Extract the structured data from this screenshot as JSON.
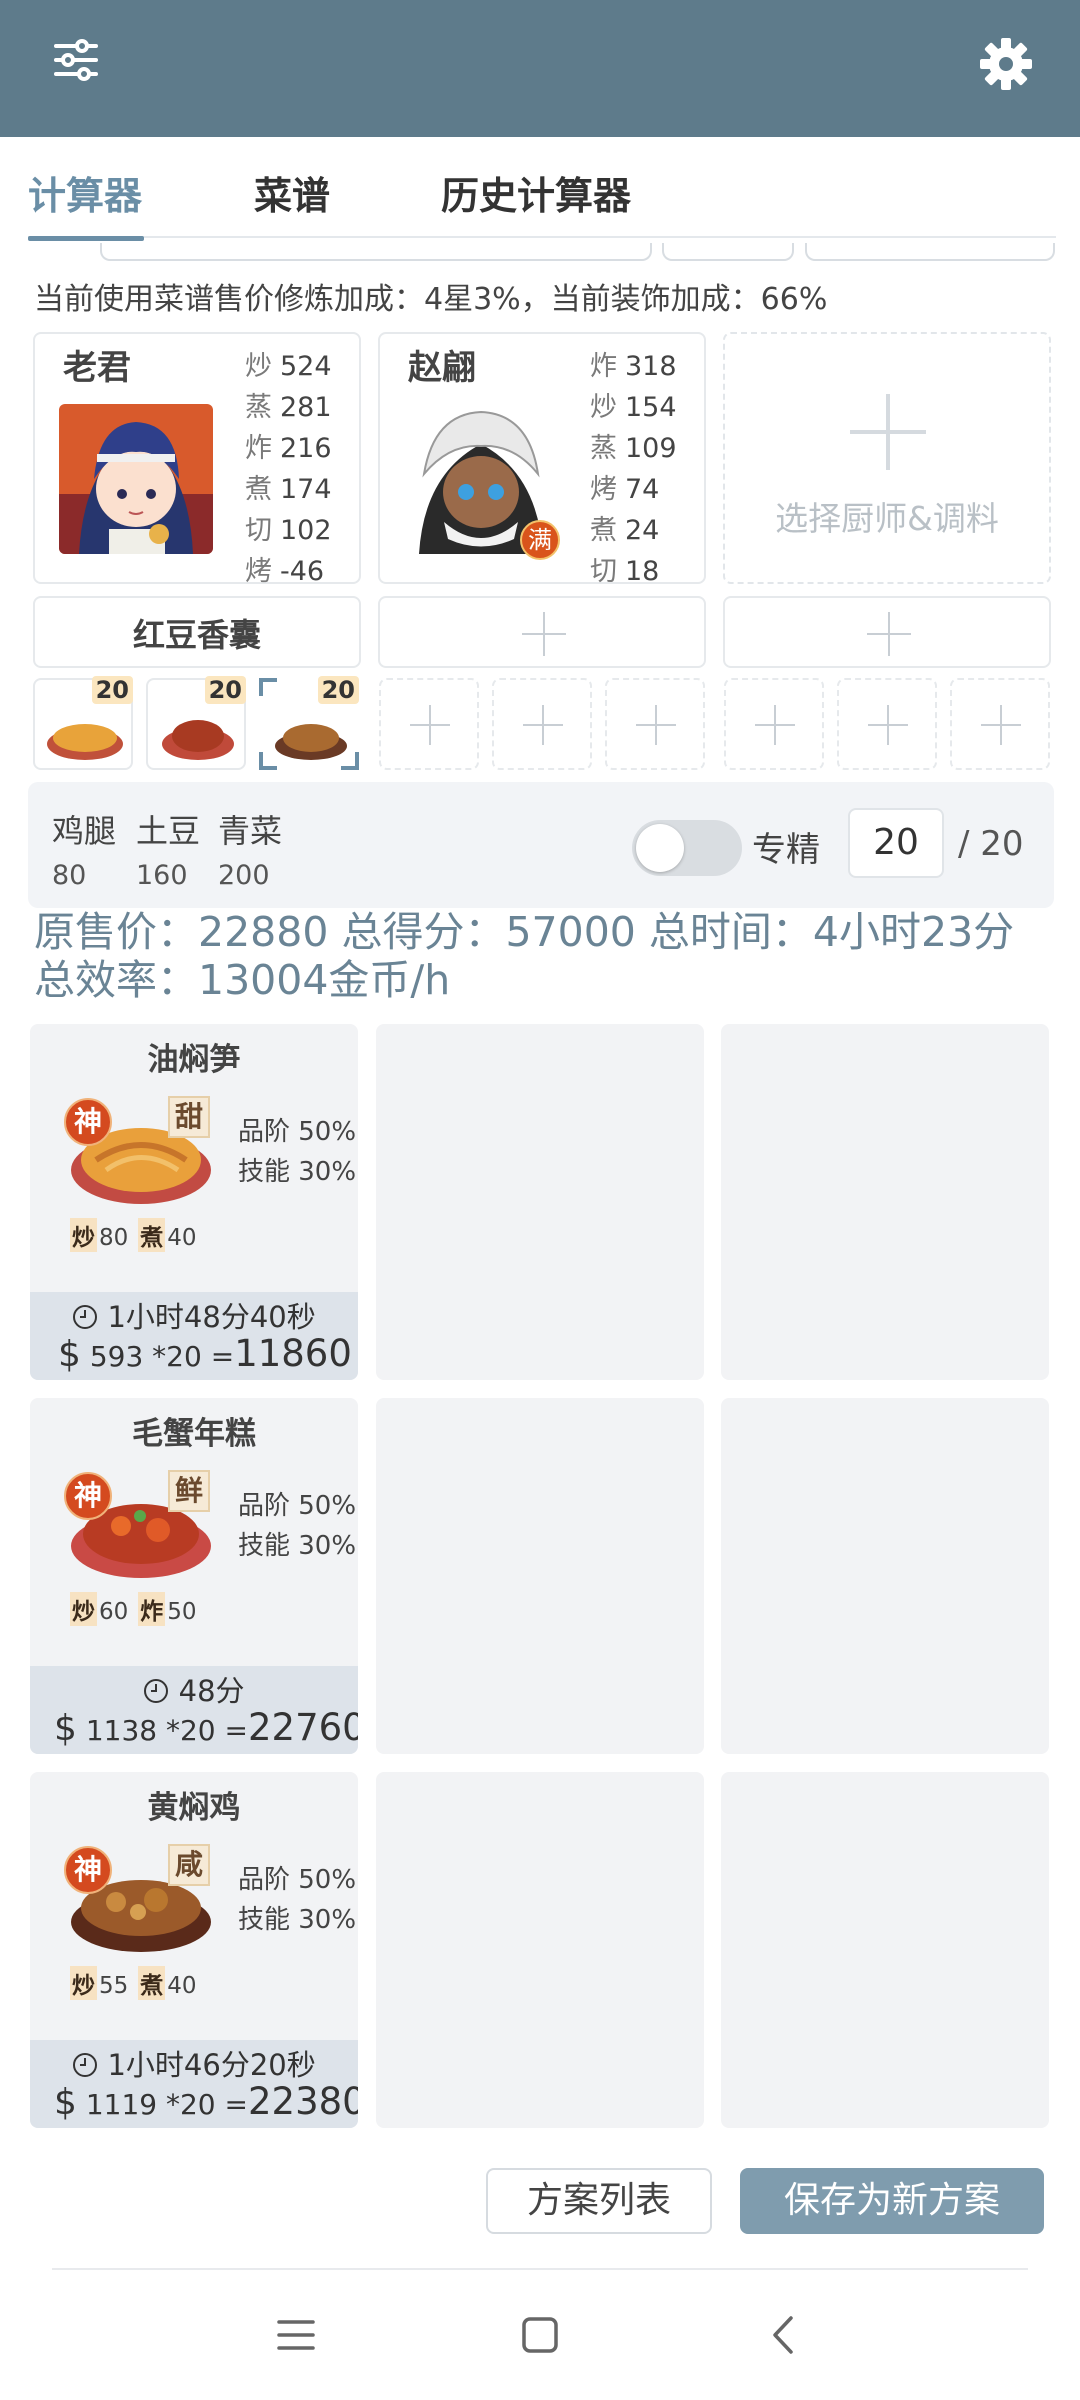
{
  "tabs": [
    {
      "label": "计算器",
      "active": true
    },
    {
      "label": "菜谱",
      "active": false
    },
    {
      "label": "历史计算器",
      "active": false
    }
  ],
  "info_line": "当前使用菜谱售价修炼加成：4星3%，当前装饰加成：66%",
  "chefs": [
    {
      "name": "老君",
      "stats": [
        {
          "k": "炒",
          "v": "524"
        },
        {
          "k": "蒸",
          "v": "281"
        },
        {
          "k": "炸",
          "v": "216"
        },
        {
          "k": "煮",
          "v": "174"
        },
        {
          "k": "切",
          "v": "102"
        },
        {
          "k": "烤",
          "v": "-46"
        }
      ]
    },
    {
      "name": "赵翩",
      "badge": "满",
      "stats": [
        {
          "k": "炸",
          "v": "318"
        },
        {
          "k": "炒",
          "v": "154"
        },
        {
          "k": "蒸",
          "v": "109"
        },
        {
          "k": "烤",
          "v": "74"
        },
        {
          "k": "煮",
          "v": "24"
        },
        {
          "k": "切",
          "v": "18"
        }
      ]
    }
  ],
  "add_chef_label": "选择厨师&调料",
  "equipment": {
    "slot1": "红豆香囊"
  },
  "dish_slots": [
    {
      "level": "20"
    },
    {
      "level": "20"
    },
    {
      "level": "20"
    }
  ],
  "materials": [
    {
      "name": "鸡腿",
      "value": "80"
    },
    {
      "name": "土豆",
      "value": "160"
    },
    {
      "name": "青菜",
      "value": "200"
    }
  ],
  "mastery": {
    "label": "专精",
    "enabled": false,
    "count": "20",
    "max": "/ 20"
  },
  "summary": {
    "line1": "原售价：22880 总得分：57000 总时间：4小时23分",
    "line2": "总效率：13004金币/h"
  },
  "recipes": [
    {
      "name": "油焖笋",
      "rank": "神",
      "taste": "甜",
      "bonus1": "品阶 50%",
      "bonus2": "技能 30%",
      "skills": [
        {
          "k": "炒",
          "v": "80"
        },
        {
          "k": "煮",
          "v": "40"
        }
      ],
      "time": "1小时48分40秒",
      "price": "593",
      "mult": "*20",
      "total": "11860"
    },
    {
      "name": "毛蟹年糕",
      "rank": "神",
      "taste": "鲜",
      "bonus1": "品阶 50%",
      "bonus2": "技能 30%",
      "skills": [
        {
          "k": "炒",
          "v": "60"
        },
        {
          "k": "炸",
          "v": "50"
        }
      ],
      "time": "48分",
      "price": "1138",
      "mult": "*20",
      "total": "22760"
    },
    {
      "name": "黄焖鸡",
      "rank": "神",
      "taste": "咸",
      "bonus1": "品阶 50%",
      "bonus2": "技能 30%",
      "skills": [
        {
          "k": "炒",
          "v": "55"
        },
        {
          "k": "煮",
          "v": "40"
        }
      ],
      "time": "1小时46分20秒",
      "price": "1119",
      "mult": "*20",
      "total": "22380"
    }
  ],
  "buttons": {
    "plan_list": "方案列表",
    "save_new": "保存为新方案"
  },
  "colors": {
    "appbar": "#5e7b8b",
    "accent": "#6a8ea6",
    "save_button": "#7f9cae"
  },
  "icons": [
    "filter-sliders-icon",
    "gear-icon",
    "plus-icon",
    "clock-icon",
    "menu-icon",
    "home-icon",
    "back-icon"
  ]
}
